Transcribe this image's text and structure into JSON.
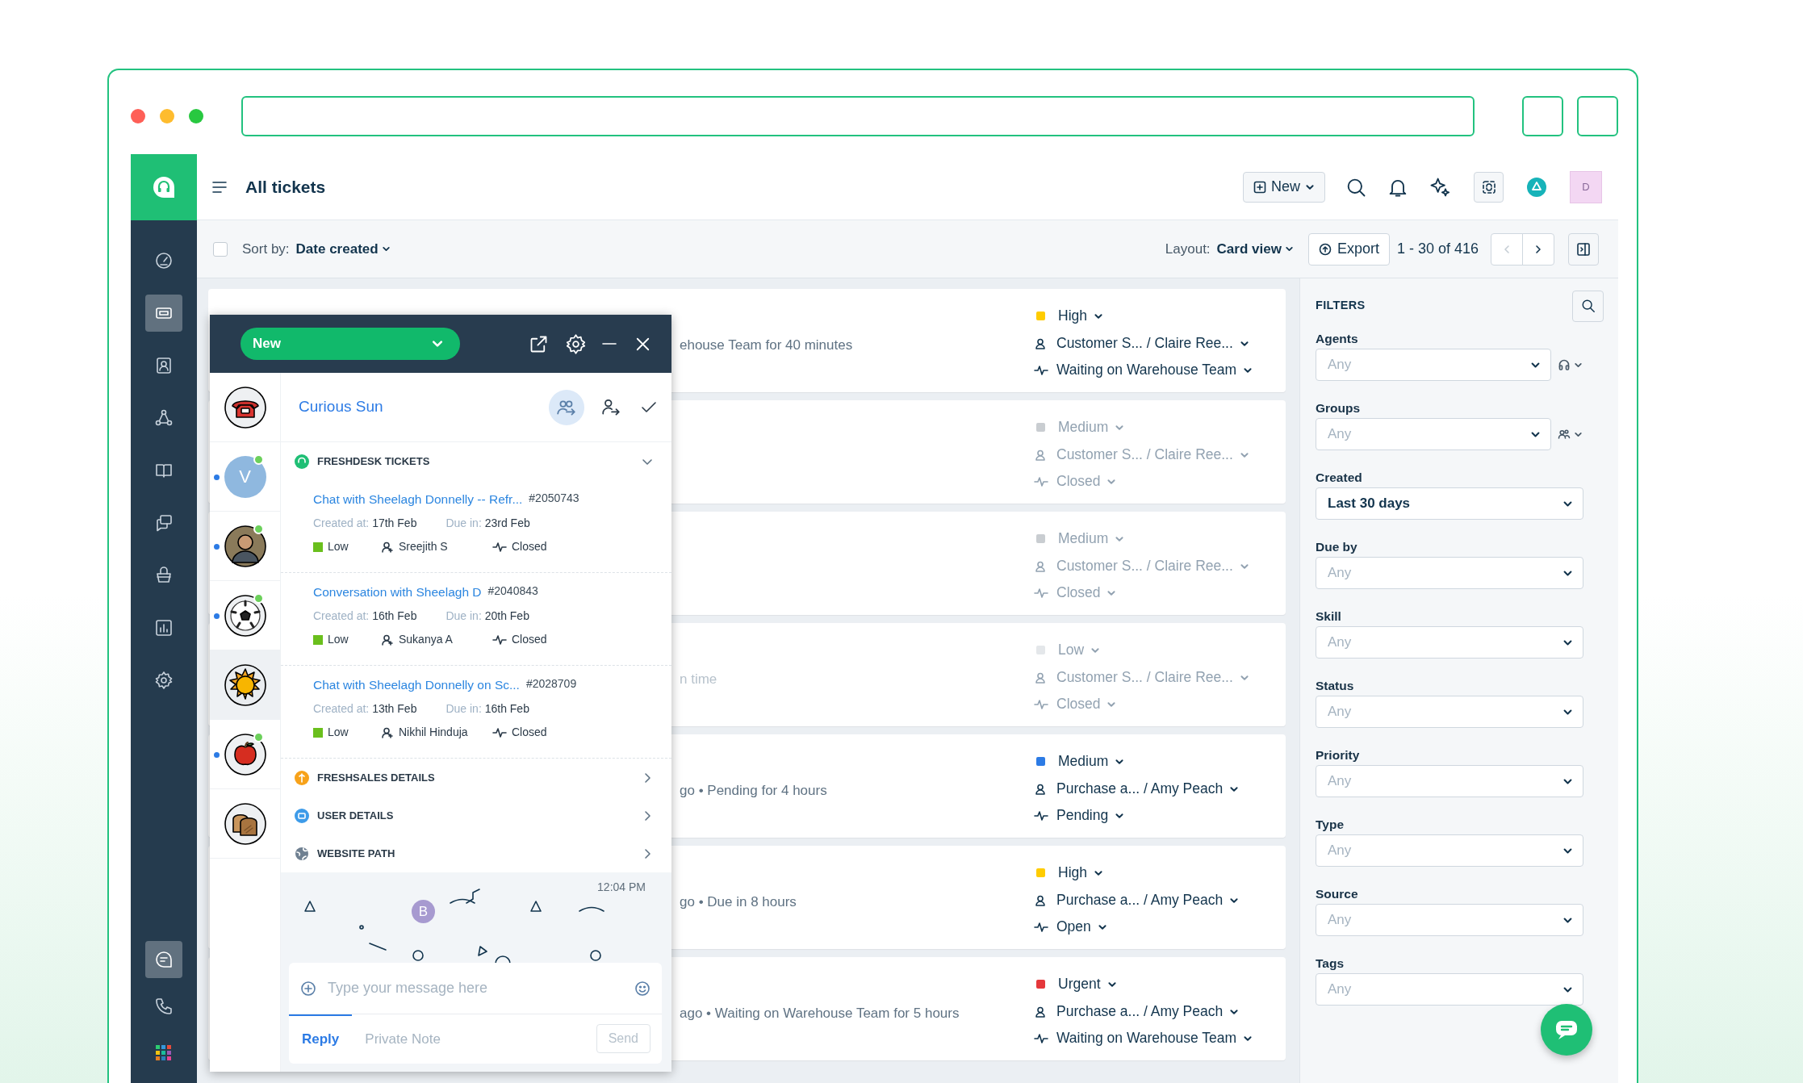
{
  "header": {
    "title": "All tickets",
    "new_button": "New",
    "avatar": "D"
  },
  "sidebar": {
    "items": [
      {
        "selected": false
      },
      {
        "selected": true
      },
      {
        "selected": false
      },
      {
        "selected": false
      },
      {
        "selected": false
      },
      {
        "selected": false
      },
      {
        "selected": false
      },
      {
        "selected": false
      },
      {
        "selected": false
      }
    ],
    "bottom_items": [
      {
        "selected": true
      },
      {
        "selected": false
      },
      {
        "selected": false
      }
    ]
  },
  "toolbar": {
    "select_all_checked": false,
    "sort_label": "Sort by:",
    "sort_value": "Date created",
    "layout_label": "Layout:",
    "layout_value": "Card view",
    "export": "Export",
    "range": "1 - 30 of 416"
  },
  "tickets": [
    {
      "meta": "ehouse Team for 40 minutes",
      "priority": "High",
      "color": "#ffcc00",
      "agent": "Customer S... / Claire Ree...",
      "status": "Waiting on Warehouse Team",
      "muted": false
    },
    {
      "priority": "Medium",
      "color": "#c9cdd1",
      "agent": "Customer S... / Claire Ree...",
      "status": "Closed",
      "muted": true
    },
    {
      "priority": "Medium",
      "color": "#c9cdd1",
      "agent": "Customer S... / Claire Ree...",
      "status": "Closed",
      "muted": true
    },
    {
      "meta": "n time",
      "priority": "Low",
      "color": "#e4e7ea",
      "agent": "Customer S... / Claire Ree...",
      "status": "Closed",
      "muted": true
    },
    {
      "meta": "go • Pending for 4 hours",
      "priority": "Medium",
      "color": "#2c7be5",
      "agent": "Purchase a... / Amy Peach",
      "status": "Pending",
      "muted": false
    },
    {
      "meta": "go • Due in 8 hours",
      "priority": "High",
      "color": "#ffcc00",
      "agent": "Purchase a... / Amy Peach",
      "status": "Open",
      "muted": false
    },
    {
      "meta": "ago • Waiting on Warehouse Team for 5 hours",
      "priority": "Urgent",
      "color": "#e5383b",
      "agent": "Purchase a... / Amy Peach",
      "status": "Waiting on Warehouse Team",
      "muted": false
    }
  ],
  "filters": {
    "title": "FILTERS",
    "fields": [
      {
        "label": "Agents",
        "placeholder": "Any",
        "kind": "agents"
      },
      {
        "label": "Groups",
        "placeholder": "Any",
        "kind": "groups"
      },
      {
        "label": "Created",
        "value": "Last 30 days",
        "kind": "plain"
      },
      {
        "label": "Due by",
        "placeholder": "Any",
        "kind": "plain"
      },
      {
        "label": "Skill",
        "placeholder": "Any",
        "kind": "plain"
      },
      {
        "label": "Status",
        "placeholder": "Any",
        "kind": "plain"
      },
      {
        "label": "Priority",
        "placeholder": "Any",
        "kind": "plain"
      },
      {
        "label": "Type",
        "placeholder": "Any",
        "kind": "plain"
      },
      {
        "label": "Source",
        "placeholder": "Any",
        "kind": "plain"
      },
      {
        "label": "Tags",
        "placeholder": "Any",
        "kind": "plain"
      }
    ]
  },
  "chat_widget": {
    "status": "New",
    "contacts": [
      {
        "kind": "phone",
        "online": false,
        "unread": false,
        "selected": false
      },
      {
        "kind": "initial",
        "initial": "V",
        "online": true,
        "unread": true,
        "selected": false
      },
      {
        "kind": "photo",
        "online": true,
        "unread": true,
        "selected": false
      },
      {
        "kind": "ball",
        "online": true,
        "unread": true,
        "selected": false
      },
      {
        "kind": "sun",
        "online": false,
        "unread": false,
        "selected": true
      },
      {
        "kind": "apple",
        "online": true,
        "unread": true,
        "selected": false
      },
      {
        "kind": "bread",
        "online": false,
        "unread": false,
        "selected": false
      }
    ],
    "contact_name": "Curious Sun",
    "sections": [
      {
        "title": "FRESHDESK TICKETS",
        "expanded": true,
        "tickets": [
          {
            "title": "Chat with Sheelagh Donnelly -- Refr...",
            "number": "#2050743",
            "created_label": "Created at:",
            "created": "17th Feb",
            "due_label": "Due in:",
            "due": "23rd Feb",
            "priority": "Low",
            "agent": "Sreejith S",
            "status": "Closed"
          },
          {
            "title": "Conversation with Sheelagh D",
            "number": "#2040843",
            "created_label": "Created at:",
            "created": "16th Feb",
            "due_label": "Due in:",
            "due": "20th Feb",
            "priority": "Low",
            "agent": "Sukanya A",
            "status": "Closed"
          },
          {
            "title": "Chat with Sheelagh Donnelly on Sc...",
            "number": "#2028709",
            "created_label": "Created at:",
            "created": "13th Feb",
            "due_label": "Due in:",
            "due": "16th Feb",
            "priority": "Low",
            "agent": "Nikhil Hinduja",
            "status": "Closed"
          }
        ]
      },
      {
        "title": "FRESHSALES DETAILS",
        "expanded": false
      },
      {
        "title": "USER DETAILS",
        "expanded": false
      },
      {
        "title": "WEBSITE PATH",
        "expanded": false
      }
    ],
    "time": "12:04 PM",
    "sender_initial": "B",
    "composer": {
      "placeholder": "Type your message here",
      "tabs": [
        {
          "label": "Reply",
          "selected": true
        },
        {
          "label": "Private Note",
          "selected": false
        }
      ],
      "send": "Send"
    }
  }
}
